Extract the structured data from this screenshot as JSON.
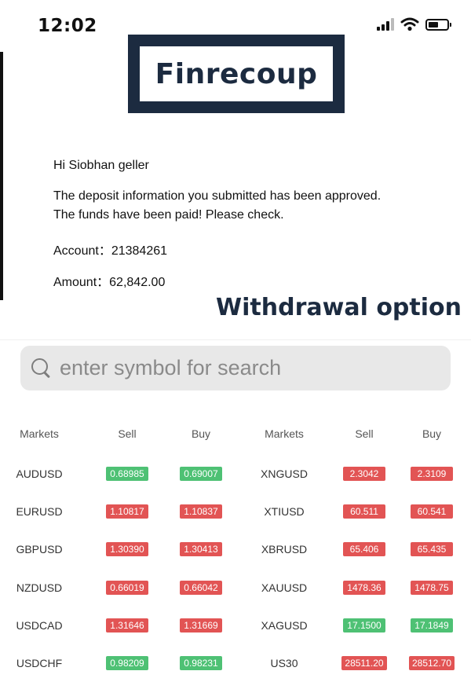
{
  "status_bar": {
    "time": "12:02"
  },
  "logo": {
    "text": "Finrecoup"
  },
  "email": {
    "greeting": "Hi  Siobhan geller",
    "message_line1": "The deposit information you submitted has been approved.",
    "message_line2": "The funds have been paid! Please check.",
    "account_label": "Account：",
    "account_value": "21384261",
    "amount_label": "Amount：",
    "amount_value": "62,842.00"
  },
  "withdrawal_title": "Withdrawal option",
  "search": {
    "placeholder": "enter symbol for search"
  },
  "colors": {
    "up": "#4ec174",
    "down": "#e25454",
    "brand": "#1c2b40"
  },
  "table": {
    "headers": [
      "Markets",
      "Sell",
      "Buy",
      "Markets",
      "Sell",
      "Buy"
    ],
    "rows": [
      {
        "m1": "AUDUSD",
        "s1": "0.68985",
        "b1": "0.69007",
        "d1": "up",
        "m2": "XNGUSD",
        "s2": "2.3042",
        "b2": "2.3109",
        "d2": "down"
      },
      {
        "m1": "EURUSD",
        "s1": "1.10817",
        "b1": "1.10837",
        "d1": "down",
        "m2": "XTIUSD",
        "s2": "60.511",
        "b2": "60.541",
        "d2": "down"
      },
      {
        "m1": "GBPUSD",
        "s1": "1.30390",
        "b1": "1.30413",
        "d1": "down",
        "m2": "XBRUSD",
        "s2": "65.406",
        "b2": "65.435",
        "d2": "down"
      },
      {
        "m1": "NZDUSD",
        "s1": "0.66019",
        "b1": "0.66042",
        "d1": "down",
        "m2": "XAUUSD",
        "s2": "1478.36",
        "b2": "1478.75",
        "d2": "down"
      },
      {
        "m1": "USDCAD",
        "s1": "1.31646",
        "b1": "1.31669",
        "d1": "down",
        "m2": "XAGUSD",
        "s2": "17.1500",
        "b2": "17.1849",
        "d2": "up"
      },
      {
        "m1": "USDCHF",
        "s1": "0.98209",
        "b1": "0.98231",
        "d1": "up",
        "m2": "US30",
        "s2": "28511.20",
        "b2": "28512.70",
        "d2": "down"
      }
    ]
  }
}
